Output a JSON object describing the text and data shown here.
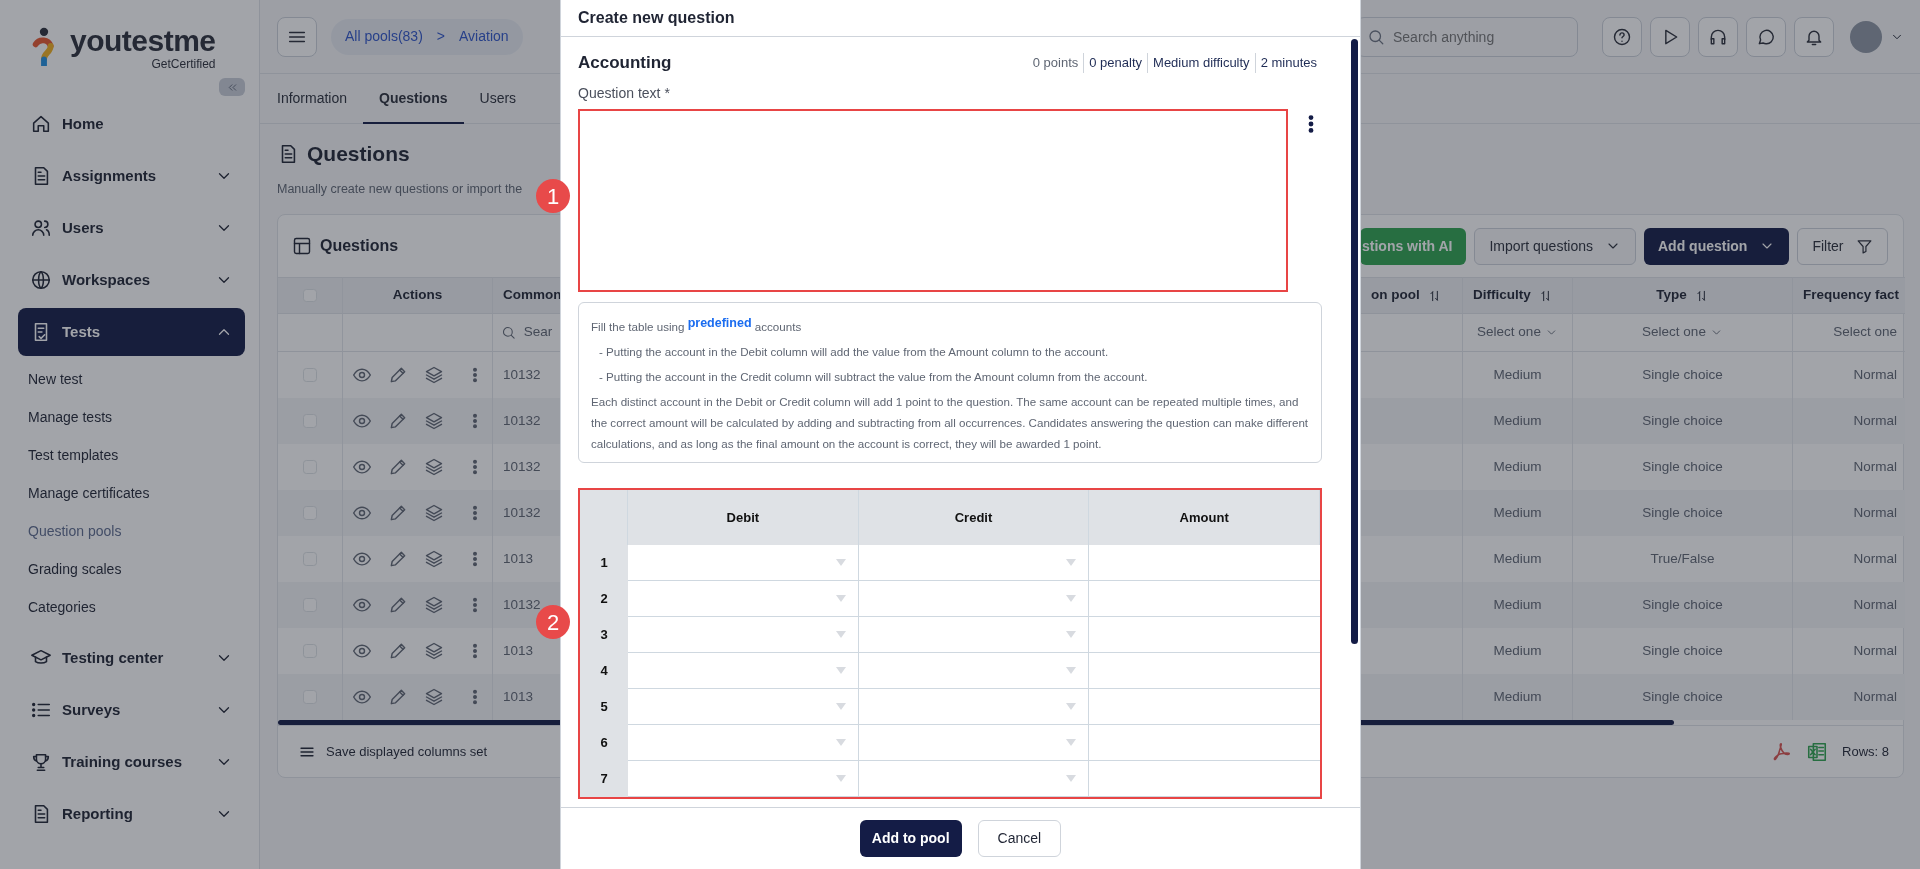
{
  "sidebar": {
    "logo": {
      "name": "youtestme",
      "tagline": "GetCertified"
    },
    "items": [
      {
        "label": "Home",
        "selected": false
      },
      {
        "label": "Assignments",
        "expanded": false,
        "selected": false
      },
      {
        "label": "Users",
        "expanded": false,
        "selected": false
      },
      {
        "label": "Workspaces",
        "expanded": false,
        "selected": false
      },
      {
        "label": "Tests",
        "expanded": true,
        "selected": true,
        "children": [
          {
            "label": "New test",
            "selected": false
          },
          {
            "label": "Manage tests",
            "selected": false
          },
          {
            "label": "Test templates",
            "selected": false
          },
          {
            "label": "Manage certificates",
            "selected": false
          },
          {
            "label": "Question pools",
            "selected": true
          },
          {
            "label": "Grading scales",
            "selected": false
          },
          {
            "label": "Categories",
            "selected": false
          }
        ]
      },
      {
        "label": "Testing center",
        "expanded": false,
        "selected": false
      },
      {
        "label": "Surveys",
        "expanded": false,
        "selected": false
      },
      {
        "label": "Training courses",
        "expanded": false,
        "selected": false
      },
      {
        "label": "Reporting",
        "expanded": false,
        "selected": false
      }
    ]
  },
  "header": {
    "breadcrumb": [
      "All pools(83)",
      "Aviation"
    ],
    "separator": ">",
    "search": {
      "placeholder": "Search anything"
    }
  },
  "tabs": [
    {
      "label": "Information",
      "selected": false
    },
    {
      "label": "Questions",
      "selected": true
    },
    {
      "label": "Users",
      "selected": false
    }
  ],
  "page": {
    "title": "Questions",
    "subtitle": "Manually create new questions or import the"
  },
  "card": {
    "title": "Questions",
    "buttons": [
      {
        "label": "stions with AI",
        "kind": "success",
        "dropdown": false
      },
      {
        "label": "Import questions",
        "kind": "outline",
        "dropdown": true
      },
      {
        "label": "Add question",
        "kind": "primary",
        "dropdown": true
      },
      {
        "label": "Filter",
        "kind": "filter",
        "dropdown": false
      }
    ],
    "table": {
      "select_all_checked": false,
      "columns": [
        {
          "label": "Actions",
          "sortable": false
        },
        {
          "label": "Common",
          "filter": {
            "kind": "search",
            "text": "Sear"
          }
        },
        {
          "label": "on pool",
          "sortable": true
        },
        {
          "label": "Difficulty",
          "sortable": true,
          "filter": {
            "kind": "select",
            "text": "Select one",
            "caret": true
          }
        },
        {
          "label": "Type",
          "sortable": true,
          "filter": {
            "kind": "select",
            "text": "Select one",
            "caret": true
          }
        },
        {
          "label": "Frequency fact",
          "filter": {
            "kind": "select",
            "text": "Select one",
            "caret": false
          }
        }
      ],
      "rows": [
        {
          "checked": false,
          "id": "10132",
          "difficulty": "Medium",
          "type": "Single choice",
          "frequency": "Normal"
        },
        {
          "checked": false,
          "id": "10132",
          "difficulty": "Medium",
          "type": "Single choice",
          "frequency": "Normal"
        },
        {
          "checked": false,
          "id": "10132",
          "difficulty": "Medium",
          "type": "Single choice",
          "frequency": "Normal"
        },
        {
          "checked": false,
          "id": "10132",
          "difficulty": "Medium",
          "type": "Single choice",
          "frequency": "Normal"
        },
        {
          "checked": false,
          "id": "1013",
          "difficulty": "Medium",
          "type": "True/False",
          "frequency": "Normal"
        },
        {
          "checked": false,
          "id": "10132",
          "difficulty": "Medium",
          "type": "Single choice",
          "frequency": "Normal"
        },
        {
          "checked": false,
          "id": "1013",
          "difficulty": "Medium",
          "type": "Single choice",
          "frequency": "Normal"
        },
        {
          "checked": false,
          "id": "1013",
          "difficulty": "Medium",
          "type": "Single choice",
          "frequency": "Normal"
        }
      ]
    },
    "footer": {
      "save_label": "Save displayed columns set",
      "rows_label": "Rows: 8"
    }
  },
  "modal": {
    "title": "Create new question",
    "question_title": "Accounting",
    "meta": [
      "0 points",
      "0 penalty",
      "Medium difficulty",
      "2 minutes"
    ],
    "question_text": {
      "label": "Question text *",
      "highlighted": true
    },
    "info": {
      "intro_before": "Fill the table using",
      "link": "predefined",
      "intro_after": "accounts",
      "bullets": [
        "- Putting the account in the Debit column will add the value from the Amount column to the account.",
        "- Putting the account in the Credit column will subtract the value from the Amount column from the account."
      ],
      "note": "Each distinct account in the Debit or Credit column will add 1 point to the question. The same account can be repeated multiple times, and the correct amount will be calculated by adding and subtracting from all occurrences. Candidates answering the question can make different calculations, and as long as the final amount on the account is correct, they will be awarded 1 point."
    },
    "table": {
      "highlighted": true,
      "columns": [
        {
          "label": "Debit",
          "kind": "dropdown"
        },
        {
          "label": "Credit",
          "kind": "dropdown"
        },
        {
          "label": "Amount",
          "kind": "input"
        }
      ],
      "rows": [
        {
          "number": "1"
        },
        {
          "number": "2"
        },
        {
          "number": "3"
        },
        {
          "number": "4"
        },
        {
          "number": "5"
        },
        {
          "number": "6"
        },
        {
          "number": "7"
        }
      ]
    },
    "buttons": [
      {
        "label": "Add to pool",
        "kind": "primary"
      },
      {
        "label": "Cancel",
        "kind": "secondary"
      }
    ]
  },
  "annotations": [
    {
      "label": "1"
    },
    {
      "label": "2"
    }
  ]
}
